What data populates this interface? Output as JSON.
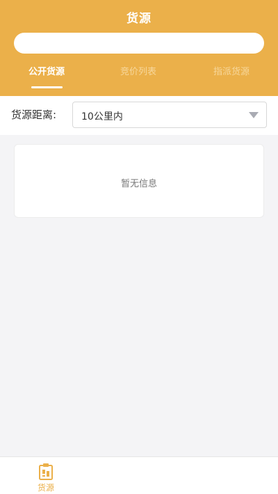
{
  "header": {
    "title": "货源",
    "search": {
      "value": "",
      "placeholder": ""
    },
    "tabs": [
      {
        "label": "公开货源",
        "active": true
      },
      {
        "label": "竞价列表",
        "active": false
      },
      {
        "label": "指派货源",
        "active": false
      }
    ]
  },
  "filter": {
    "label": "货源距离:",
    "selected": "10公里内"
  },
  "list": {
    "empty_text": "暂无信息"
  },
  "bottom_nav": {
    "items": [
      {
        "label": "货源",
        "icon": "clipboard-icon",
        "active": true
      }
    ]
  },
  "colors": {
    "accent": "#ebb04a",
    "background": "#f4f4f6",
    "tab_inactive": "#f7d79b"
  }
}
